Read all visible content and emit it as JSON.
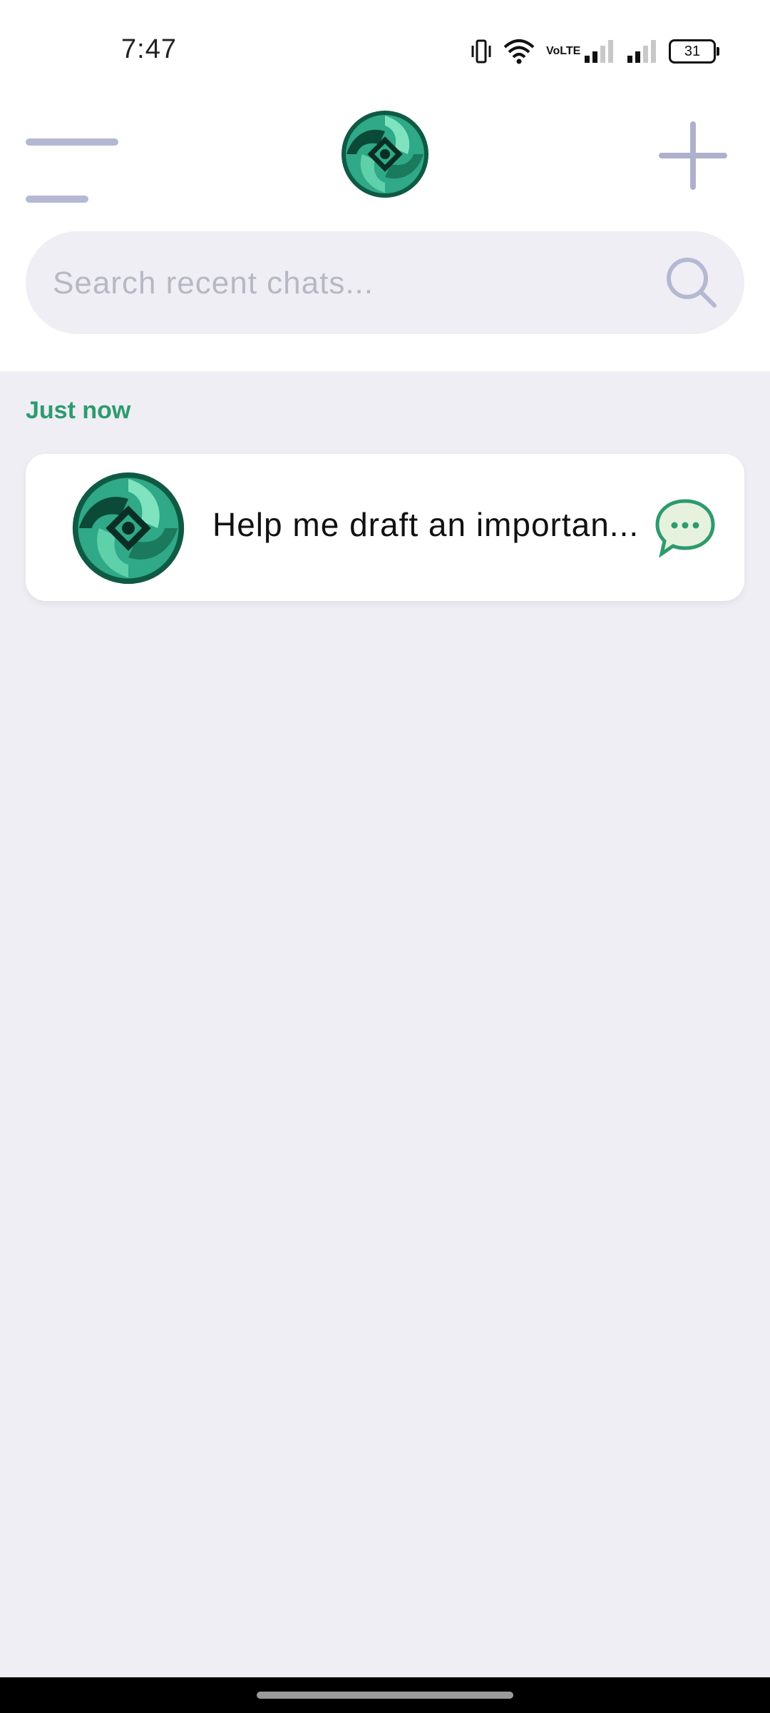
{
  "status_bar": {
    "time": "7:47",
    "network_label": "VoLTE",
    "battery": "31"
  },
  "header": {
    "menu_icon": "hamburger-menu-icon",
    "logo": "app-logo",
    "new_chat_icon": "plus-icon"
  },
  "search": {
    "placeholder": "Search recent chats...",
    "icon": "search-icon"
  },
  "section": {
    "label": "Just now"
  },
  "chats": [
    {
      "title": "Help me draft an importan...",
      "icon": "chat-bubble-icon"
    }
  ],
  "colors": {
    "accent_green": "#2e9a6e",
    "icon_gray": "#aeb1cc",
    "background": "#eeeef4"
  }
}
